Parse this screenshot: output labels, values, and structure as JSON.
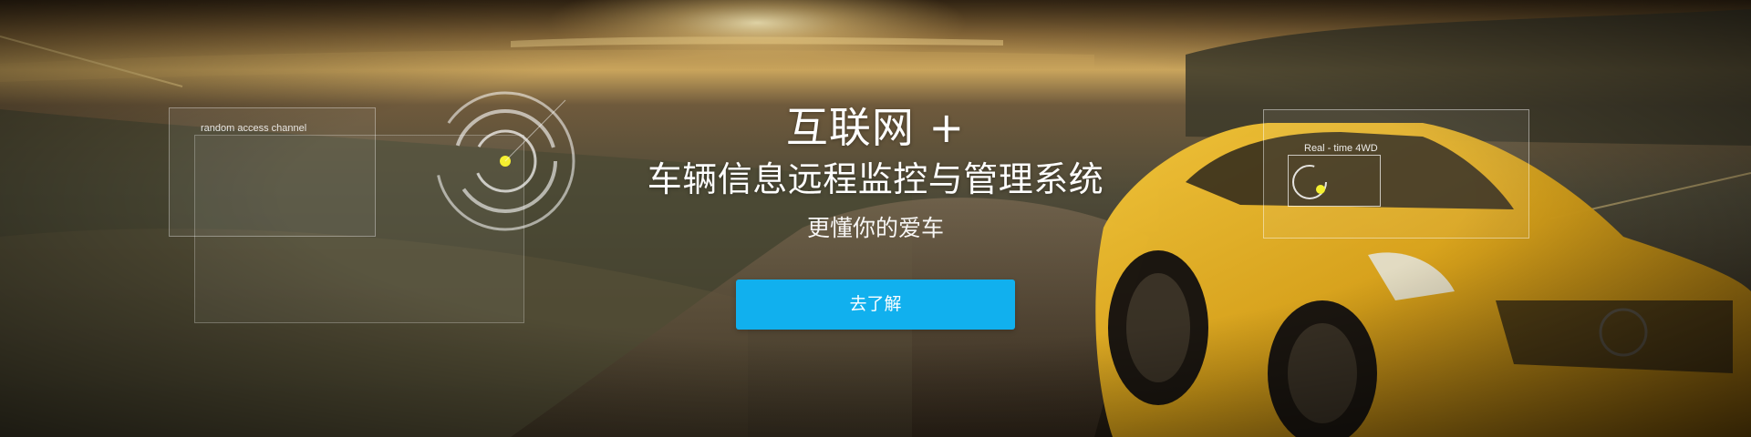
{
  "hero": {
    "title_line1": "互联网 +",
    "title_line2": "车辆信息远程监控与管理系统",
    "subtitle": "更懂你的爱车"
  },
  "cta": {
    "label": "去了解"
  },
  "hud": {
    "left_label": "random access channel",
    "right_label": "Real - time 4WD"
  },
  "colors": {
    "cta_background": "#11b0ee",
    "sky_gold": "#c9a45c",
    "car_yellow": "#d9a21a",
    "text_white": "#ffffff",
    "hud_accent": "#f5f030"
  }
}
